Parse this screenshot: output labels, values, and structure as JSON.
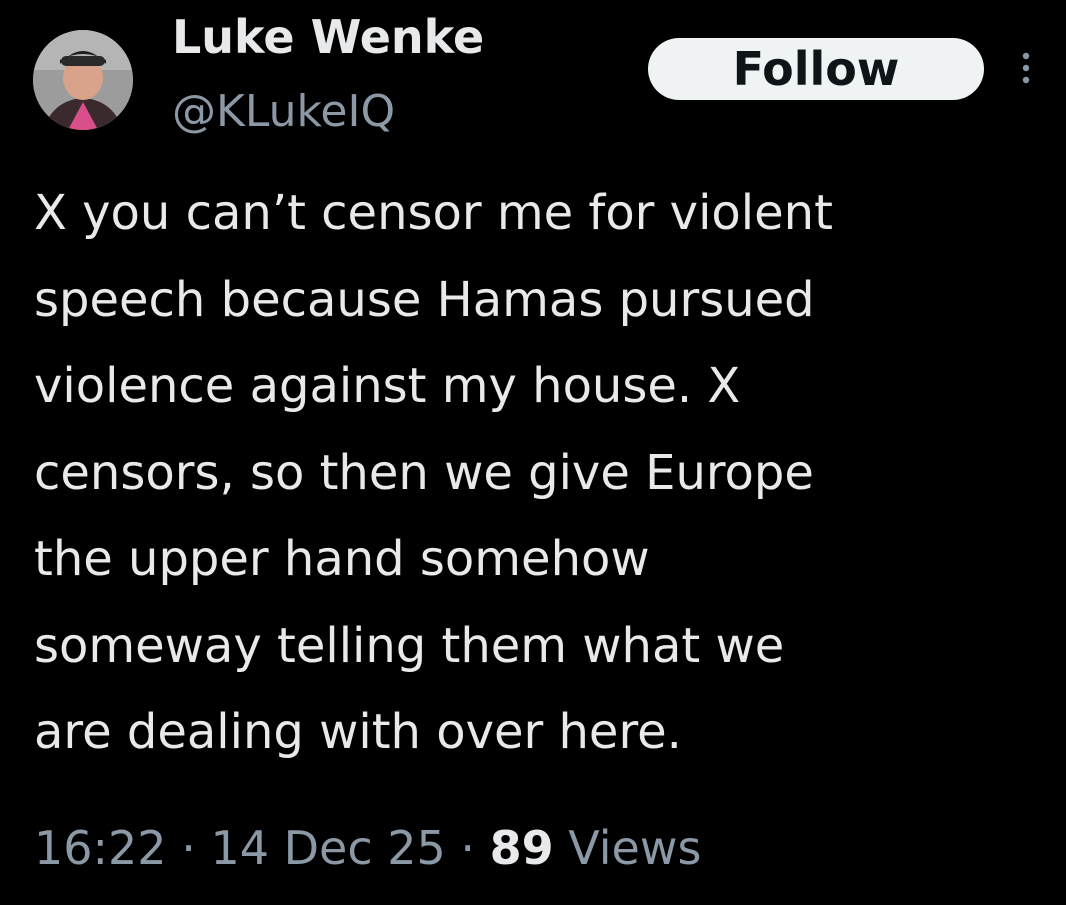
{
  "author": {
    "display_name": "Luke Wenke",
    "handle": "@KLukeIQ"
  },
  "actions": {
    "follow_label": "Follow",
    "more_icon": "more-vertical-icon"
  },
  "tweet": {
    "lines": [
      "X you can’t censor me for violent",
      "speech because Hamas pursued",
      "violence against my house.  X",
      "censors, so then we give Europe",
      "the upper hand somehow",
      "someway telling them what we",
      "are dealing with over here."
    ]
  },
  "meta": {
    "time": "16:22",
    "separator": "·",
    "date": "14 Dec 25",
    "views_count": "89",
    "views_label": "Views"
  },
  "colors": {
    "background": "#000000",
    "primary_text": "#e7e9ea",
    "secondary_text": "#8b98a5",
    "follow_bg": "#eff3f4",
    "follow_text": "#0f1419"
  }
}
